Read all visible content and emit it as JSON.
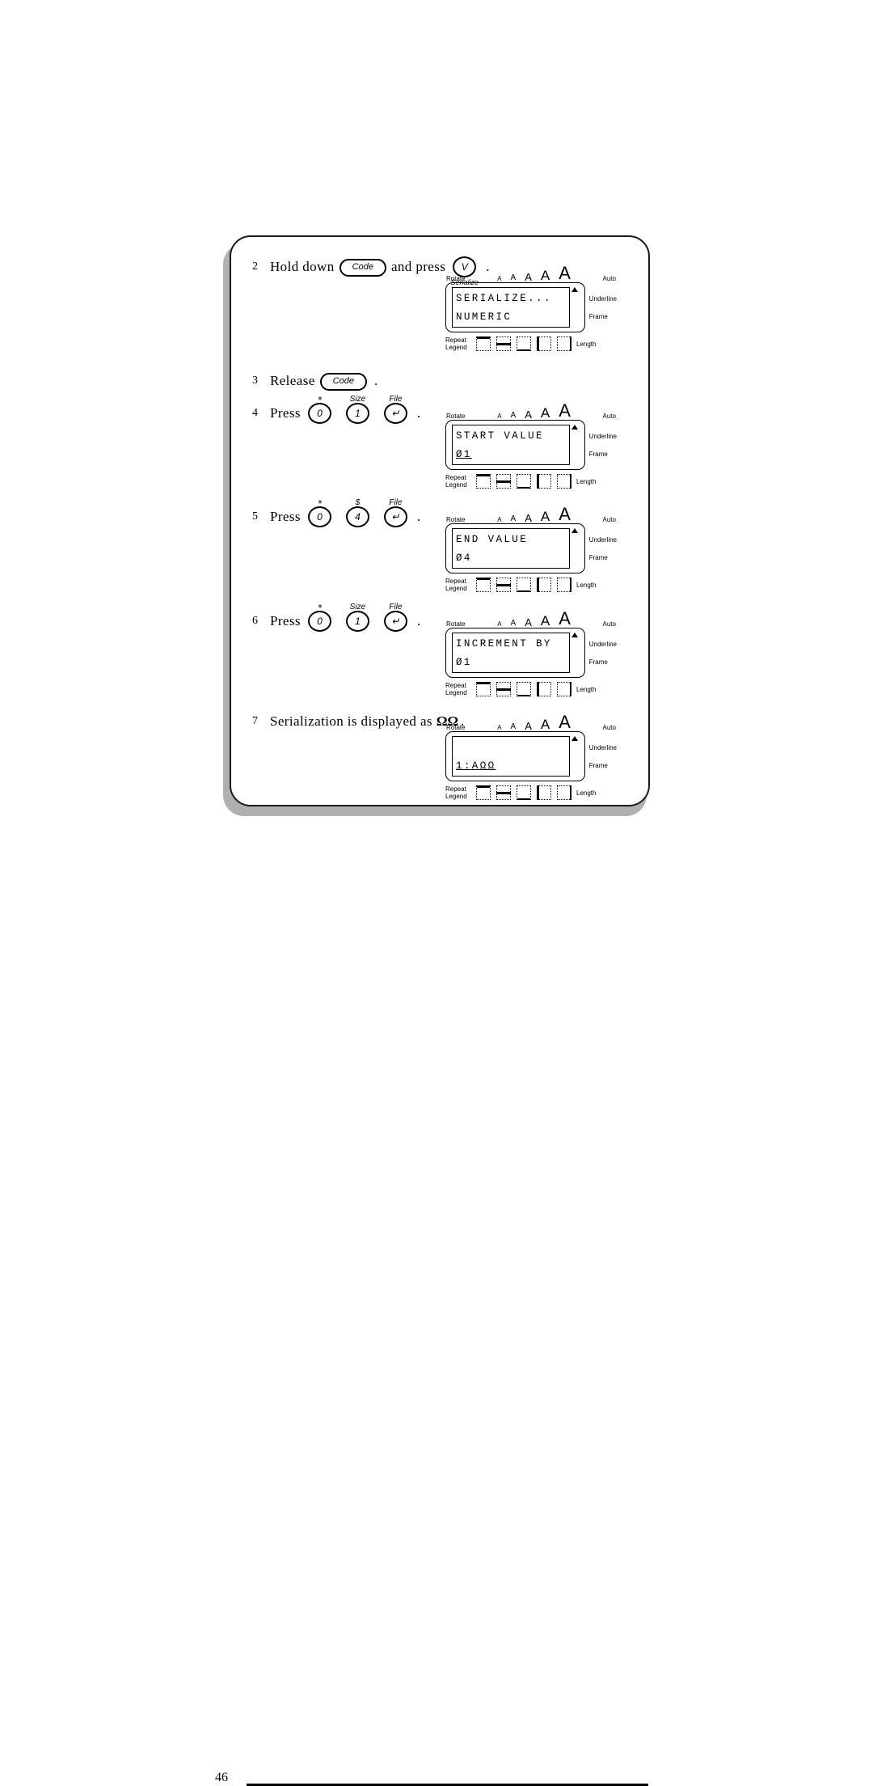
{
  "document": {
    "page_number": "46"
  },
  "panel": {
    "steps": [
      {
        "number": "2",
        "text_before": "Hold down",
        "key_code_label": "Code",
        "text_middle": "and press",
        "key_circle_label": "V",
        "key_circle_sub": "Serialize",
        "text_after": "."
      },
      {
        "number": "3",
        "text_before": "Release",
        "key_code_label": "Code",
        "text_after": "."
      },
      {
        "number": "4",
        "text_before": "Press",
        "keys": [
          {
            "label": "0",
            "sup": "*",
            "sub": ""
          },
          {
            "label": "1",
            "sup": "Size",
            "sub": ""
          },
          {
            "label": "↵",
            "sup": "File",
            "sub": ""
          }
        ],
        "text_after": "."
      },
      {
        "number": "5",
        "text_before": "Press",
        "keys": [
          {
            "label": "0",
            "sup": "*",
            "sub": ""
          },
          {
            "label": "4",
            "sup": "$",
            "sub": ""
          },
          {
            "label": "↵",
            "sup": "File",
            "sub": ""
          }
        ],
        "text_after": "."
      },
      {
        "number": "6",
        "text_before": "Press",
        "keys": [
          {
            "label": "0",
            "sup": "*",
            "sub": ""
          },
          {
            "label": "1",
            "sup": "Size",
            "sub": ""
          },
          {
            "label": "↵",
            "sup": "File",
            "sub": ""
          }
        ],
        "text_after": "."
      },
      {
        "number": "7",
        "text_before": "Serialization is displayed as",
        "emphasis": "ΩΩ",
        "text_after": "."
      }
    ],
    "lcd_common": {
      "rotate_label": "Rotate",
      "auto_label": "Auto",
      "underline_label": "Underline",
      "frame_label": "Frame",
      "repeat_label": "Repeat",
      "legend_label": "Legend",
      "length_label": "Length",
      "size_scale": [
        "A",
        "A",
        "A",
        "A",
        "A"
      ]
    },
    "displays": [
      {
        "id": "serialize",
        "line1": "SERIALIZE...",
        "line2": "NUMERIC",
        "cursor_line": 0
      },
      {
        "id": "start",
        "line1": "START VALUE",
        "line2": "Ø1",
        "cursor_line": 2,
        "cursor_char": "1"
      },
      {
        "id": "end",
        "line1": "END VALUE",
        "line2": "Ø4",
        "cursor_line": 0
      },
      {
        "id": "increment",
        "line1": "INCREMENT BY",
        "line2": "Ø1",
        "cursor_line": 0
      },
      {
        "id": "result",
        "line1": "",
        "line2": "1:AΩΩ",
        "cursor_line": 0
      }
    ]
  }
}
